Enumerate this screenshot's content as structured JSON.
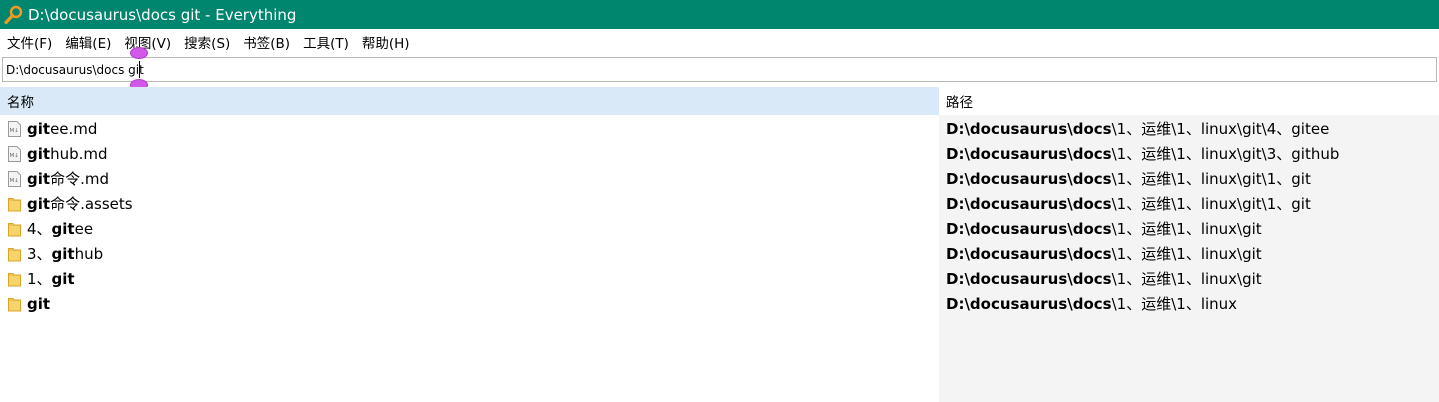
{
  "window": {
    "title": "D:\\docusaurus\\docs git - Everything"
  },
  "menu": [
    "文件(F)",
    "编辑(E)",
    "视图(V)",
    "搜索(S)",
    "书签(B)",
    "工具(T)",
    "帮助(H)"
  ],
  "search": {
    "value": "D:\\docusaurus\\docs git"
  },
  "columns": {
    "name": "名称",
    "path": "路径"
  },
  "rows": [
    {
      "icon": "markdown-file-icon",
      "name_bold": "git",
      "name_rest": "ee.md",
      "name_pre": "",
      "path_bold": "D:\\docusaurus\\docs",
      "path_rest": "\\1、运维\\1、linux\\git\\4、gitee"
    },
    {
      "icon": "markdown-file-icon",
      "name_bold": "git",
      "name_rest": "hub.md",
      "name_pre": "",
      "path_bold": "D:\\docusaurus\\docs",
      "path_rest": "\\1、运维\\1、linux\\git\\3、github"
    },
    {
      "icon": "markdown-file-icon",
      "name_bold": "git",
      "name_rest": "命令.md",
      "name_pre": "",
      "path_bold": "D:\\docusaurus\\docs",
      "path_rest": "\\1、运维\\1、linux\\git\\1、git"
    },
    {
      "icon": "folder-icon",
      "name_bold": "git",
      "name_rest": "命令.assets",
      "name_pre": "",
      "path_bold": "D:\\docusaurus\\docs",
      "path_rest": "\\1、运维\\1、linux\\git\\1、git"
    },
    {
      "icon": "folder-icon",
      "name_pre": "4、",
      "name_bold": "git",
      "name_rest": "ee",
      "path_bold": "D:\\docusaurus\\docs",
      "path_rest": "\\1、运维\\1、linux\\git"
    },
    {
      "icon": "folder-icon",
      "name_pre": "3、",
      "name_bold": "git",
      "name_rest": "hub",
      "path_bold": "D:\\docusaurus\\docs",
      "path_rest": "\\1、运维\\1、linux\\git"
    },
    {
      "icon": "folder-icon",
      "name_pre": "1、",
      "name_bold": "git",
      "name_rest": "",
      "path_bold": "D:\\docusaurus\\docs",
      "path_rest": "\\1、运维\\1、linux\\git"
    },
    {
      "icon": "folder-icon",
      "name_pre": "",
      "name_bold": "git",
      "name_rest": "",
      "path_bold": "D:\\docusaurus\\docs",
      "path_rest": "\\1、运维\\1、linux"
    }
  ],
  "colors": {
    "titlebar": "#00856f",
    "header_selected": "#d9e9f8",
    "path_bg": "#f4f4f4",
    "selection_handle": "#d158e9"
  }
}
